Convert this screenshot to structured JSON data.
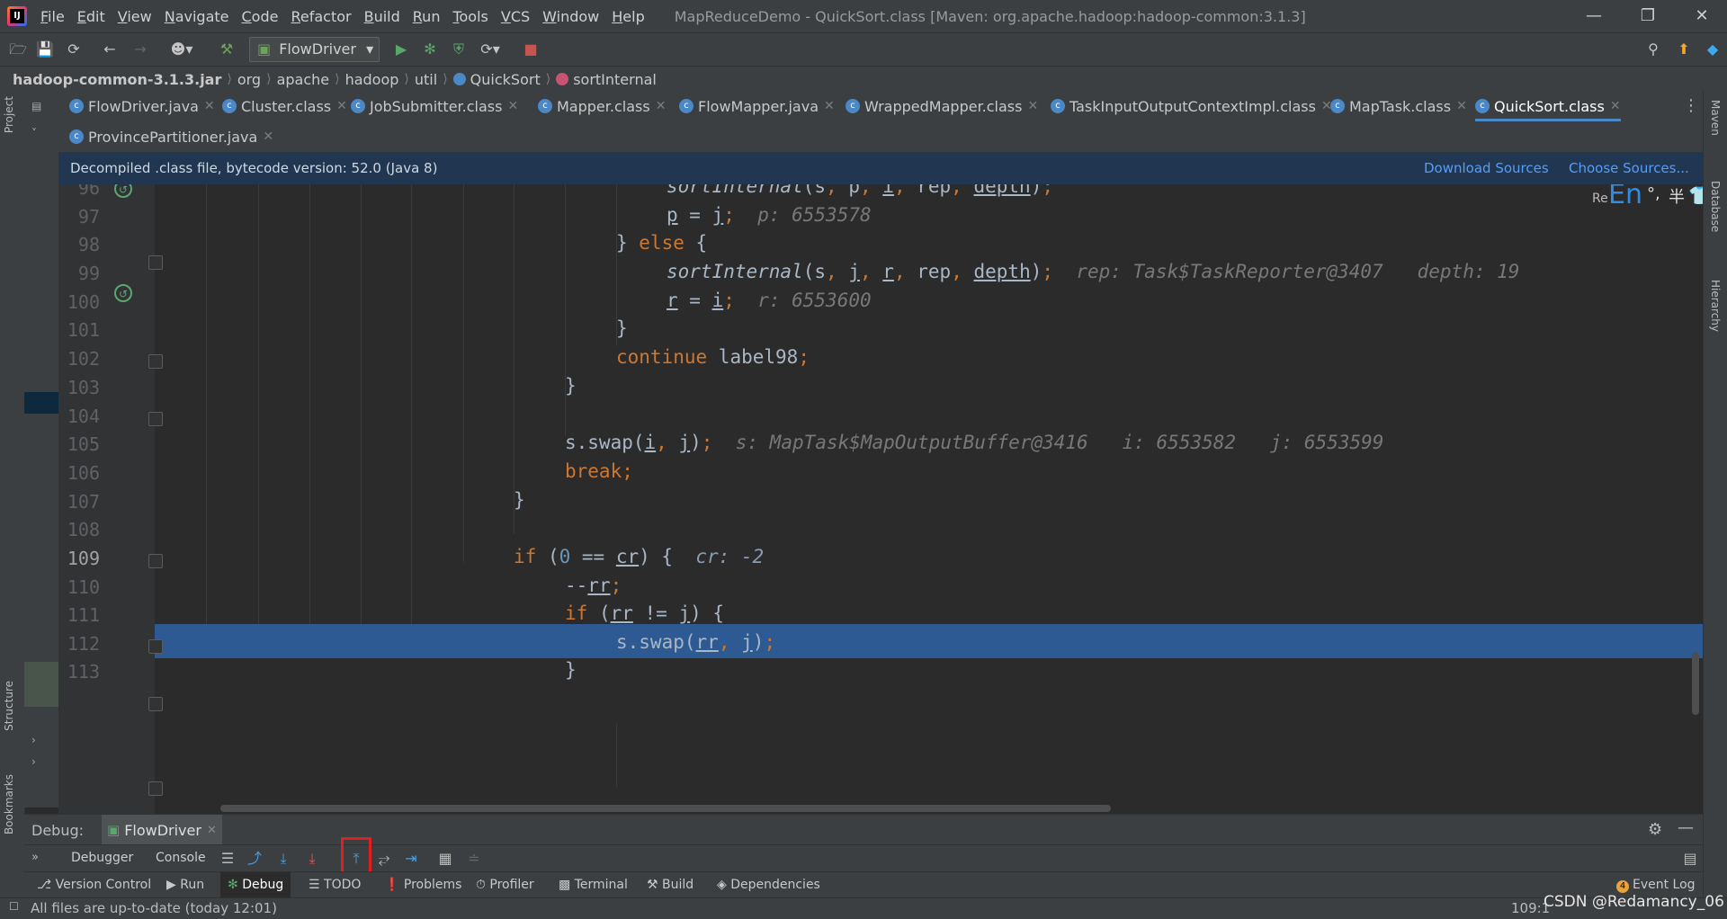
{
  "menu": [
    "File",
    "Edit",
    "View",
    "Navigate",
    "Code",
    "Refactor",
    "Build",
    "Run",
    "Tools",
    "VCS",
    "Window",
    "Help"
  ],
  "window_title": "MapReduceDemo - QuickSort.class [Maven: org.apache.hadoop:hadoop-common:3.1.3]",
  "toolbar": {
    "run_config": "FlowDriver"
  },
  "breadcrumb": [
    "hadoop-common-3.1.3.jar",
    "org",
    "apache",
    "hadoop",
    "util",
    "QuickSort",
    "sortInternal"
  ],
  "tabs_row1": [
    {
      "label": "FlowDriver.java"
    },
    {
      "label": "Cluster.class"
    },
    {
      "label": "JobSubmitter.class"
    },
    {
      "label": "Mapper.class"
    },
    {
      "label": "FlowMapper.java"
    },
    {
      "label": "WrappedMapper.class"
    },
    {
      "label": "TaskInputOutputContextImpl.class"
    },
    {
      "label": "MapTask.class"
    },
    {
      "label": "QuickSort.class",
      "active": true
    }
  ],
  "tabs_row2": [
    {
      "label": "ProvincePartitioner.java"
    }
  ],
  "banner": {
    "text": "Decompiled .class file, bytecode version: 52.0 (Java 8)",
    "download_sources": "Download Sources",
    "choose_sources": "Choose Sources..."
  },
  "ime": {
    "re": "Re",
    "lang": "En",
    "punct": "°,",
    "half": "半"
  },
  "editor": {
    "lines": [
      "96",
      "97",
      "98",
      "99",
      "100",
      "101",
      "102",
      "103",
      "104",
      "105",
      "106",
      "107",
      "108",
      "109",
      "110",
      "111",
      "112",
      "113"
    ],
    "current_line": "109",
    "hints": {
      "l97": "p: 6553578",
      "l99": "rep: Task$TaskReporter@3407   depth: 19",
      "l100": "r: 6553600",
      "l105": "s: MapTask$MapOutputBuffer@3416   i: 6553582   j: 6553599",
      "l109": "cr: -2"
    }
  },
  "debug": {
    "label": "Debug:",
    "session": "FlowDriver",
    "tabs": [
      "Debugger",
      "Console"
    ]
  },
  "toolwindows": [
    "Version Control",
    "Run",
    "Debug",
    "TODO",
    "Problems",
    "Profiler",
    "Terminal",
    "Build",
    "Dependencies"
  ],
  "event_log": {
    "label": "Event Log",
    "count": "4"
  },
  "left_strip": [
    "Project",
    "Structure",
    "Bookmarks"
  ],
  "right_strip": [
    "Maven",
    "Database",
    "Hierarchy"
  ],
  "status": {
    "message": "All files are up-to-date (today 12:01)",
    "position": "109:1",
    "watermark": "CSDN @Redamancy_06"
  }
}
